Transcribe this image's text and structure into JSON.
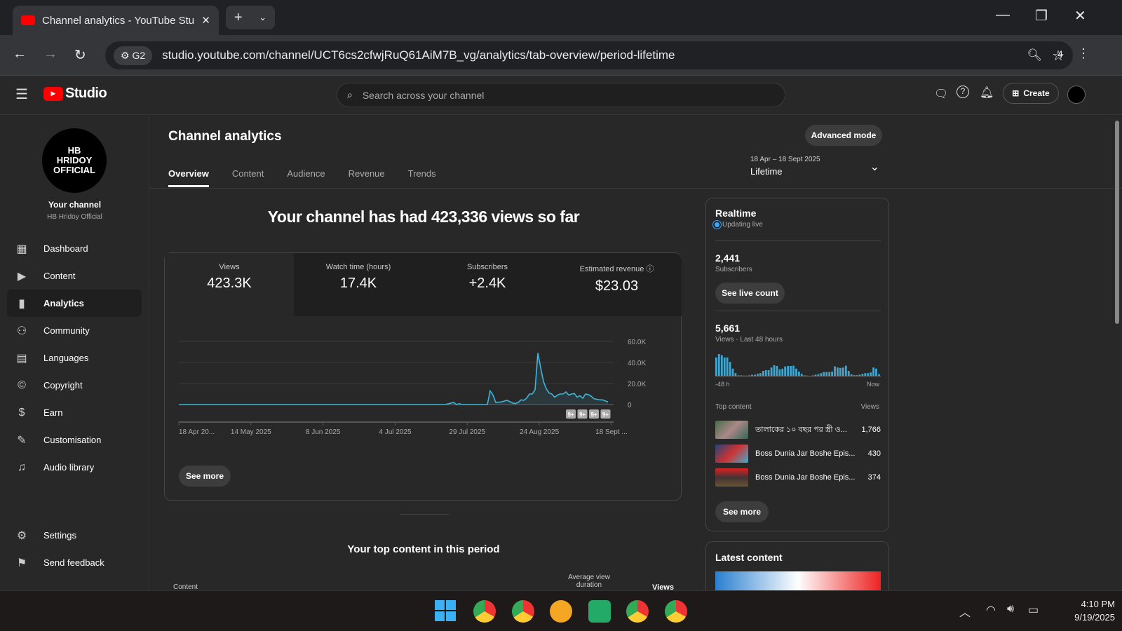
{
  "browser": {
    "tab_title": "Channel analytics - YouTube Studio",
    "url": "studio.youtube.com/channel/UCT6cs2cfwjRuQ61AiM7B_vg/analytics/tab-overview/period-lifetime",
    "site_chip": "G2",
    "extensions_count": "4"
  },
  "header": {
    "logo": "Studio",
    "search_placeholder": "Search across your channel",
    "create": "Create"
  },
  "sidebar": {
    "channel_logo_text": "HB HRIDOY OFFICIAL",
    "your_channel": "Your channel",
    "channel_name": "HB Hridoy Official",
    "items": [
      {
        "label": "Dashboard",
        "icon": "dashboard-icon"
      },
      {
        "label": "Content",
        "icon": "content-icon"
      },
      {
        "label": "Analytics",
        "icon": "analytics-icon"
      },
      {
        "label": "Community",
        "icon": "community-icon"
      },
      {
        "label": "Languages",
        "icon": "languages-icon"
      },
      {
        "label": "Copyright",
        "icon": "copyright-icon"
      },
      {
        "label": "Earn",
        "icon": "earn-icon"
      },
      {
        "label": "Customisation",
        "icon": "customisation-icon"
      },
      {
        "label": "Audio library",
        "icon": "audio-library-icon"
      }
    ],
    "settings": "Settings",
    "feedback": "Send feedback"
  },
  "page": {
    "title": "Channel analytics",
    "advanced": "Advanced mode",
    "tabs": [
      "Overview",
      "Content",
      "Audience",
      "Revenue",
      "Trends"
    ],
    "period_range": "18 Apr – 18 Sept 2025",
    "period": "Lifetime",
    "headline": "Your channel has had 423,336 views so far",
    "metrics": [
      {
        "label": "Views",
        "value": "423.3K"
      },
      {
        "label": "Watch time (hours)",
        "value": "17.4K"
      },
      {
        "label": "Subscribers",
        "value": "+2.4K"
      },
      {
        "label": "Estimated revenue",
        "value": "$23.03"
      }
    ],
    "see_more": "See more",
    "top_content_title": "Your top content in this period",
    "col_content": "Content",
    "col_avd": "Average view duration",
    "col_views": "Views",
    "badges": [
      "9+",
      "9+",
      "9+",
      "9+"
    ]
  },
  "chart_data": {
    "type": "area",
    "title": "Views",
    "x_labels": [
      "18 Apr 20...",
      "14 May 2025",
      "8 Jun 2025",
      "4 Jul 2025",
      "29 Jul 2025",
      "24 Aug 2025",
      "18 Sept ..."
    ],
    "y_ticks": [
      "60.0K",
      "40.0K",
      "20.0K",
      "0"
    ],
    "ylim": [
      0,
      60000
    ],
    "days": 155,
    "points": [
      [
        0,
        0
      ],
      [
        95,
        0
      ],
      [
        98,
        2000
      ],
      [
        99,
        0
      ],
      [
        100,
        800
      ],
      [
        101,
        0
      ],
      [
        110,
        0
      ],
      [
        111,
        13000
      ],
      [
        112,
        9000
      ],
      [
        113,
        2000
      ],
      [
        115,
        2500
      ],
      [
        117,
        4000
      ],
      [
        119,
        1500
      ],
      [
        120,
        1000
      ],
      [
        121,
        2000
      ],
      [
        122,
        4500
      ],
      [
        123,
        4000
      ],
      [
        124,
        6000
      ],
      [
        125,
        10000
      ],
      [
        126,
        10000
      ],
      [
        127,
        14000
      ],
      [
        128,
        49000
      ],
      [
        129,
        35000
      ],
      [
        130,
        22000
      ],
      [
        131,
        15000
      ],
      [
        132,
        11000
      ],
      [
        133,
        10000
      ],
      [
        134,
        7000
      ],
      [
        135,
        9000
      ],
      [
        136,
        10000
      ],
      [
        137,
        10000
      ],
      [
        138,
        12000
      ],
      [
        139,
        9000
      ],
      [
        140,
        10000
      ],
      [
        141,
        10500
      ],
      [
        142,
        7000
      ],
      [
        143,
        8500
      ],
      [
        144,
        6000
      ],
      [
        145,
        10000
      ],
      [
        146,
        9500
      ],
      [
        147,
        8000
      ],
      [
        148,
        5500
      ],
      [
        149,
        5000
      ],
      [
        150,
        4500
      ],
      [
        151,
        4500
      ],
      [
        152,
        3500
      ],
      [
        153,
        2500
      ]
    ]
  },
  "realtime": {
    "title": "Realtime",
    "status": "Updating live",
    "subs": "2,441",
    "subs_label": "Subscribers",
    "live_count": "See live count",
    "views": "5,661",
    "views_label": "Views · Last 48 hours",
    "start": "-48 h",
    "end": "Now",
    "bars": [
      85,
      100,
      95,
      85,
      85,
      65,
      35,
      15,
      5,
      5,
      4,
      4,
      5,
      8,
      8,
      12,
      15,
      25,
      28,
      28,
      40,
      50,
      47,
      32,
      35,
      45,
      47,
      47,
      48,
      35,
      22,
      12,
      5,
      4,
      2,
      5,
      8,
      10,
      15,
      20,
      20,
      20,
      22,
      45,
      40,
      38,
      40,
      48,
      25,
      10,
      6,
      6,
      8,
      12,
      15,
      15,
      18,
      40,
      35,
      10
    ],
    "top_content": "Top content",
    "views_col": "Views",
    "items": [
      {
        "title": "তালাকের ১০ বছর পর স্ত্রী ও...",
        "views": "1,766"
      },
      {
        "title": "Boss Dunia Jar Boshe Epis...",
        "views": "430"
      },
      {
        "title": "Boss Dunia Jar Boshe Epis...",
        "views": "374"
      }
    ],
    "see_more": "See more",
    "latest": "Latest content"
  },
  "taskbar": {
    "time": "4:10 PM",
    "date": "9/19/2025"
  },
  "colors": {
    "accent": "#3ea6ff",
    "line": "#41b4d8",
    "bg": "#282828"
  }
}
